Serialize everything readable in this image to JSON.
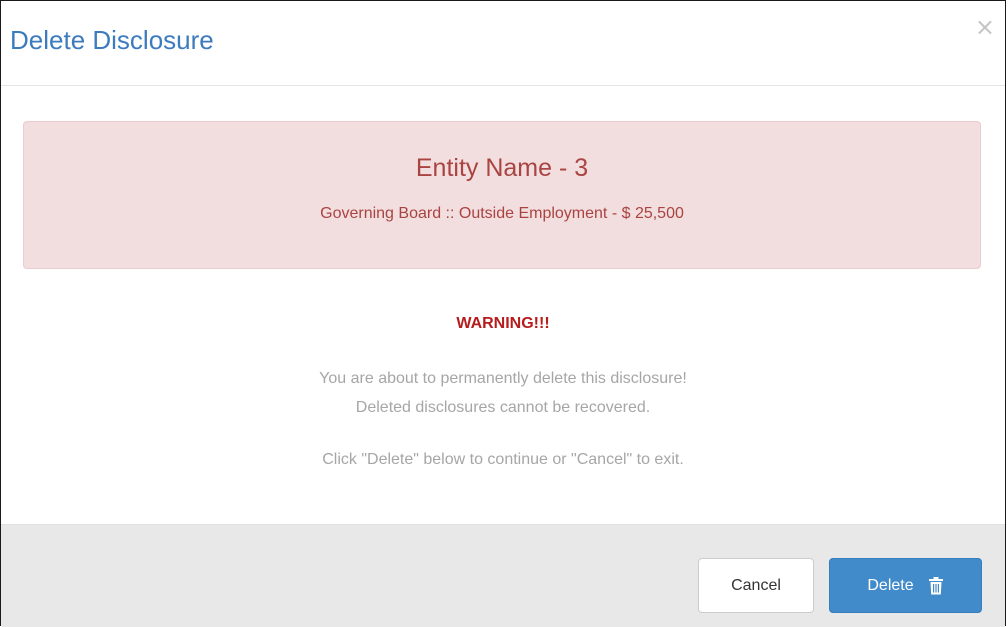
{
  "dialog": {
    "title": "Delete Disclosure",
    "close_symbol": "×"
  },
  "alert": {
    "entity": "Entity Name - 3",
    "detail": "Governing Board :: Outside Employment - $ 25,500"
  },
  "warning": {
    "heading": "WARNING!!!",
    "line1": "You are about to permanently delete this disclosure!",
    "line2": "Deleted disclosures cannot be recovered.",
    "line3": "Click \"Delete\" below to continue or \"Cancel\" to exit."
  },
  "footer": {
    "cancel_label": "Cancel",
    "delete_label": "Delete",
    "delete_icon": "trash-icon"
  },
  "colors": {
    "title": "#3d7bbf",
    "alert_bg": "#f2dede",
    "alert_text": "#a94442",
    "warning": "#b71c1c",
    "primary": "#428bca"
  }
}
